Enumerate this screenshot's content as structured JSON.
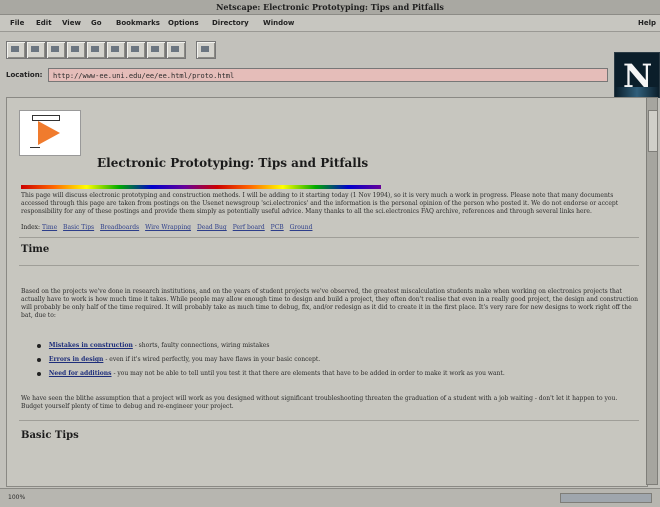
{
  "window": {
    "title": "Netscape: Electronic Prototyping: Tips and Pitfalls"
  },
  "menu": {
    "items": [
      "File",
      "Edit",
      "View",
      "Go",
      "Bookmarks",
      "Options",
      "Directory",
      "Window"
    ],
    "help": "Help"
  },
  "location": {
    "label": "Location:",
    "url": "http://www-ee.uni.edu/ee/ee.html/proto.html"
  },
  "brand": {
    "logo_letter": "N"
  },
  "page": {
    "title": "Electronic Prototyping: Tips and Pitfalls",
    "intro": "This page will discuss electronic prototyping and construction methods. I will be adding to it starting today (1 Nov 1994), so it is very much a work in progress. Please note that many documents accessed through this page are taken from postings on the Usenet newsgroup 'sci.electronics' and the information is the personal opinion of the person who posted it. We do not endorse or accept responsibility for any of these postings and provide them simply as potentially useful advice. Many thanks to all the sci.electronics FAQ archive, references and through several links here.",
    "index_label": "Index:",
    "index_links": [
      "Time",
      "Basic Tips",
      "Breadboards",
      "Wire Wrapping",
      "Dead Bug",
      "Perf board",
      "PCB",
      "Ground"
    ],
    "section_time": "Time",
    "time_para": "Based on the projects we've done in research institutions, and on the years of student projects we've observed, the greatest miscalculation students make when working on electronics projects that actually have to work is how much time it takes. While people may allow enough time to design and build a project, they often don't realise that even in a really good project, the design and construction will probably be only half of the time required. It will probably take as much time to debug, fix, and/or redesign as it did to create it in the first place. It's very rare for new designs to work right off the bat, due to:",
    "bullets": [
      {
        "strong": "Mistakes in construction",
        "text": " - shorts, faulty connections, wiring mistakes"
      },
      {
        "strong": "Errors in design",
        "text": " - even if it's wired perfectly, you may have flaws in your basic concept."
      },
      {
        "strong": "Need for additions",
        "text": " - you may not be able to tell until you test it that there are elements that have to be added in order to make it work as you want."
      }
    ],
    "closing_para": "We have seen the blithe assumption that a project will work as you designed without significant troubleshooting threaten the graduation of a student with a job waiting - don't let it happen to you. Budget yourself plenty of time to debug and re-engineer your project.",
    "section_basic": "Basic Tips"
  },
  "status": {
    "text": "100%",
    "progress_fraction": 1.0
  },
  "colors": {
    "accent_link": "#2d3e8a",
    "location_field": "#e5bdb9",
    "orange_opamp": "#f07b2d"
  }
}
